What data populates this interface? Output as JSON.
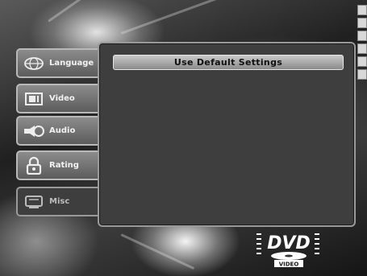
{
  "menu": {
    "tabs": [
      {
        "label": "Language",
        "icon": "globe-icon"
      },
      {
        "label": "Video",
        "icon": "monitor-icon"
      },
      {
        "label": "Audio",
        "icon": "speaker-icon"
      },
      {
        "label": "Rating",
        "icon": "lock-icon"
      },
      {
        "label": "Misc",
        "icon": "misc-icon"
      }
    ],
    "active_tab": "Misc"
  },
  "panel": {
    "items": [
      {
        "label": "Use Default Settings"
      }
    ]
  },
  "logo": {
    "text": "DVD",
    "subtext": "VIDEO"
  },
  "colors": {
    "panel_bg": "#3e3e3e",
    "tab_bg": "#7a7a7a",
    "highlight": "#c9c9c9"
  }
}
